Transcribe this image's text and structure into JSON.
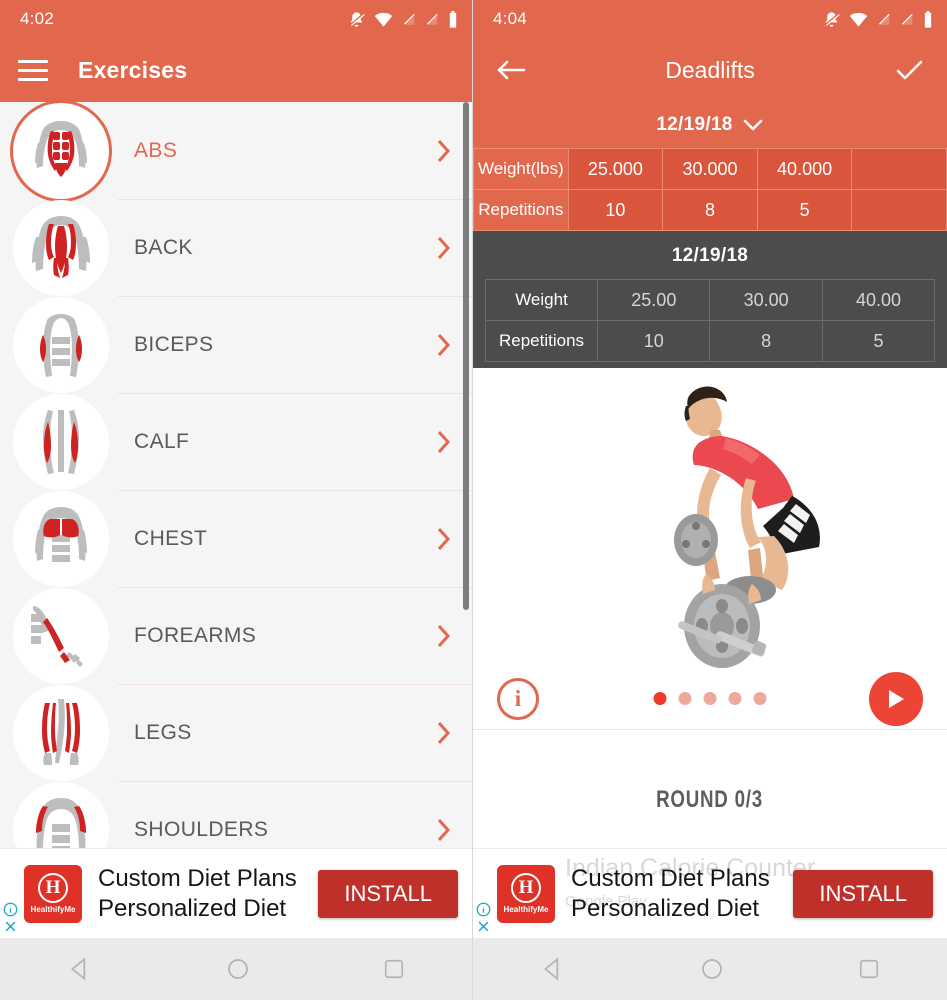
{
  "left": {
    "status": {
      "time": "4:02",
      "icons": [
        "bell-off-icon",
        "wifi-icon",
        "signal-off-icon",
        "signal-off-icon",
        "battery-icon"
      ]
    },
    "appbar": {
      "menu_icon": "hamburger-icon",
      "title": "Exercises"
    },
    "list": [
      {
        "label": "ABS",
        "icon": "abs-muscle-icon",
        "selected": true
      },
      {
        "label": "BACK",
        "icon": "back-muscle-icon",
        "selected": false
      },
      {
        "label": "BICEPS",
        "icon": "biceps-muscle-icon",
        "selected": false
      },
      {
        "label": "CALF",
        "icon": "calf-muscle-icon",
        "selected": false
      },
      {
        "label": "CHEST",
        "icon": "chest-muscle-icon",
        "selected": false
      },
      {
        "label": "FOREARMS",
        "icon": "forearms-muscle-icon",
        "selected": false
      },
      {
        "label": "LEGS",
        "icon": "legs-muscle-icon",
        "selected": false
      },
      {
        "label": "SHOULDERS",
        "icon": "shoulders-muscle-icon",
        "selected": false
      }
    ]
  },
  "right": {
    "status": {
      "time": "4:04"
    },
    "appbar": {
      "back_icon": "arrow-left-icon",
      "title": "Deadlifts",
      "confirm_icon": "check-icon"
    },
    "date_selector": {
      "value": "12/19/18",
      "chevron": "chevron-down-icon"
    },
    "entry_table": {
      "rows": [
        {
          "label": "Weight(lbs)",
          "values": [
            "25.000",
            "30.000",
            "40.000",
            ""
          ]
        },
        {
          "label": "Repetitions",
          "values": [
            "10",
            "8",
            "5",
            ""
          ]
        }
      ]
    },
    "history": {
      "date": "12/19/18",
      "rows": [
        {
          "label": "Weight",
          "values": [
            "25.00",
            "30.00",
            "40.00"
          ]
        },
        {
          "label": "Repetitions",
          "values": [
            "10",
            "8",
            "5"
          ]
        }
      ]
    },
    "media": {
      "image": "deadlift-photo",
      "info_icon": "info-icon",
      "play_icon": "play-icon",
      "dots_total": 5,
      "dots_active_index": 0
    },
    "round": {
      "text": "ROUND 0/3"
    }
  },
  "ad": {
    "logo_mark": "H",
    "brand": "HealthifyMe",
    "line1": "Custom Diet Plans",
    "line2": "Personalized Diet",
    "install_label": "INSTALL",
    "ghost_line1": "Indian Calorie",
    "ghost_line2": "Counter",
    "ghost_store": "Google Play",
    "info_badge": "info-icon",
    "close_badge": "close-icon"
  },
  "navbar": {
    "back": "nav-back-icon",
    "home": "nav-home-icon",
    "recents": "nav-recents-icon"
  },
  "colors": {
    "accent": "#e2684d",
    "accent_dark": "#d9563c",
    "dark_panel": "#4c4c4c",
    "play_red": "#ec4435",
    "ad_red": "#c0302b",
    "muscle_red": "#cf2222"
  }
}
